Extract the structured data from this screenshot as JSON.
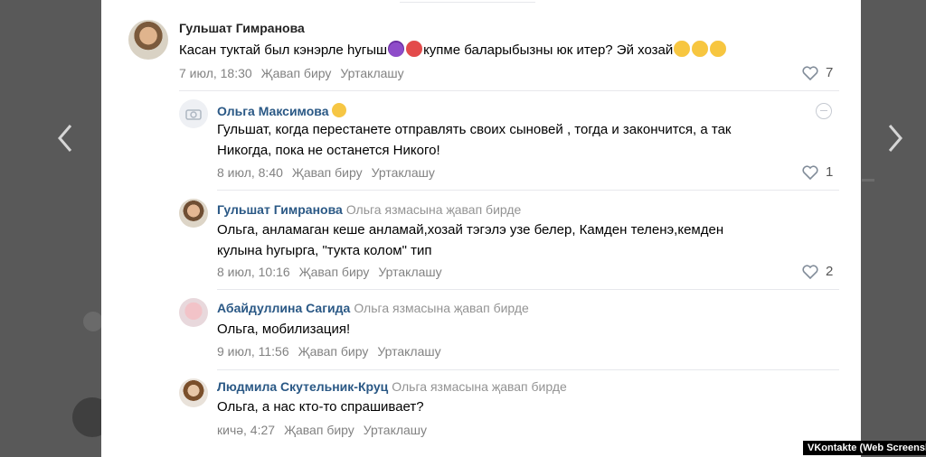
{
  "nav": {
    "prev_icon": "chevron-left-icon",
    "next_icon": "chevron-right-icon"
  },
  "comments": [
    {
      "author": "Гульшат Гимранова",
      "text_before_emoji": "Касан туктай был кэнэрле һугыш",
      "text_after_emoji": "купме баларыбызны юк итер? Эй хозай",
      "date": "7 июл, 18:30",
      "reply": "Җавап биру",
      "share": "Уртаклашу",
      "likes": "7"
    },
    {
      "author": "Ольга Максимова",
      "text_line1": "Гульшат, когда перестанете отправлять своих сыновей , тогда и закончится, а так",
      "text_line2": "Никогда, пока не останется Никого!",
      "date": "8 июл, 8:40",
      "reply": "Җавап биру",
      "share": "Уртаклашу",
      "likes": "1"
    },
    {
      "author": "Гульшат Гимранова",
      "reply_to": "Ольга язмасына җавап бирде",
      "text_line1": "Ольга, анламаган кеше анламай,хозай тэгэлэ узе белер, Камден теленэ,кемден",
      "text_line2": "кулына һугырга, \"тукта колом\" тип",
      "date": "8 июл, 10:16",
      "reply": "Җавап биру",
      "share": "Уртаклашу",
      "likes": "2"
    },
    {
      "author": "Абайдуллина Сагида",
      "reply_to": "Ольга язмасына җавап бирде",
      "text_line1": "Ольга, мобилизация!",
      "date": "9 июл, 11:56",
      "reply": "Җавап биру",
      "share": "Уртаклашу"
    },
    {
      "author": "Людмила Скутельник-Круц",
      "reply_to": "Ольга язмасына җавап бирде",
      "text_line1": "Ольга, а нас кто-то спрашивает?",
      "date": "кичә, 4:27",
      "reply": "Җавап биру",
      "share": "Уртаклашу"
    }
  ],
  "watermark": "VKontakte (Web Screenshot)"
}
